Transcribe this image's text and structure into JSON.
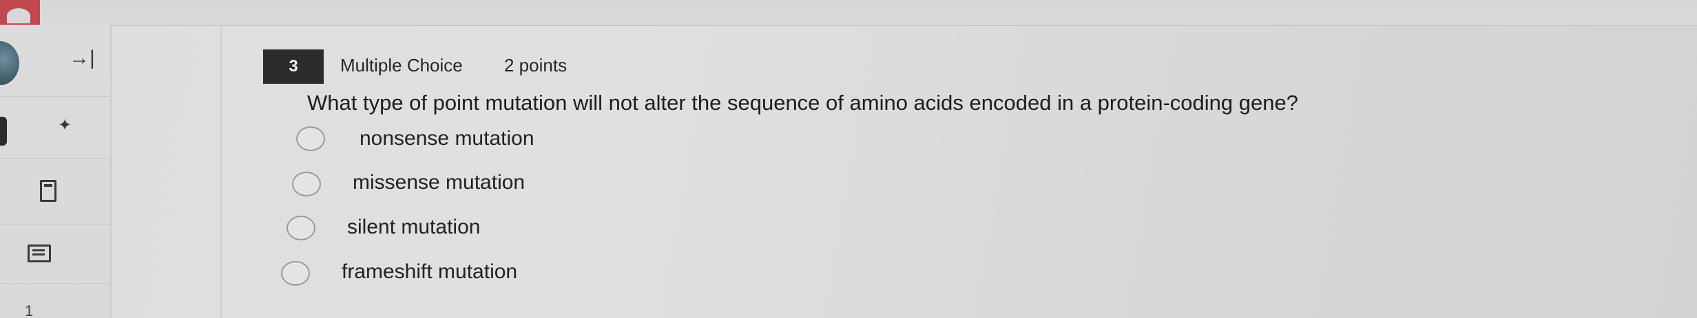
{
  "sidebar": {
    "collapse_icon": "collapse-right-icon",
    "pin_icon": "pin-icon",
    "flag_icon": "flag-icon",
    "notes_icon": "notes-icon",
    "page_number": "1"
  },
  "question": {
    "number": "3",
    "type": "Multiple Choice",
    "points": "2 points",
    "text": "What type of point mutation will not alter the sequence of amino acids encoded in a protein-coding gene?",
    "options": [
      {
        "label": "nonsense mutation",
        "selected": false
      },
      {
        "label": "missense mutation",
        "selected": false
      },
      {
        "label": "silent mutation",
        "selected": false
      },
      {
        "label": "frameshift mutation",
        "selected": false
      }
    ]
  },
  "colors": {
    "brand": "#c0484e",
    "question_number_bg": "#2c2c2c",
    "page_bg": "#dedede"
  }
}
